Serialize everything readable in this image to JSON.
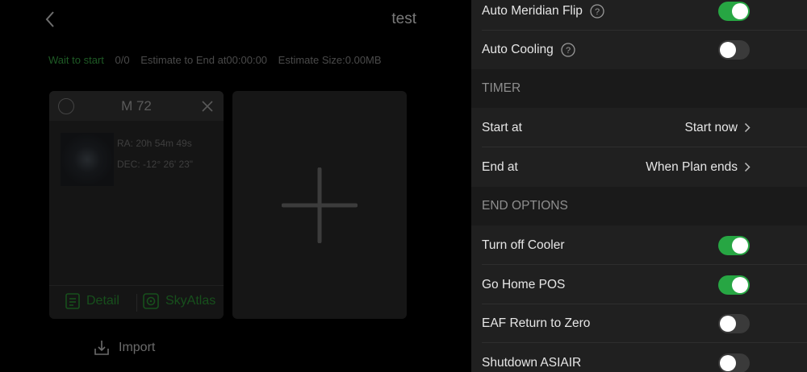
{
  "plan": {
    "title": "test",
    "status": {
      "state": "Wait to start",
      "progress": "0/0",
      "estimate_end": "Estimate to End at00:00:00",
      "estimate_size": "Estimate Size:0.00MB"
    },
    "target": {
      "name": "M 72",
      "ra": "RA: 20h 54m 49s",
      "dec": "DEC: -12° 26' 23\"",
      "detail_label": "Detail",
      "skyatlas_label": "SkyAtlas"
    },
    "import_label": "Import"
  },
  "settings": {
    "auto_meridian_flip": {
      "label": "Auto Meridian Flip",
      "on": true
    },
    "auto_cooling": {
      "label": "Auto Cooling",
      "on": false
    },
    "timer_section": "TIMER",
    "start_at": {
      "label": "Start at",
      "value": "Start now"
    },
    "end_at": {
      "label": "End at",
      "value": "When Plan ends"
    },
    "end_options_section": "END OPTIONS",
    "turn_off_cooler": {
      "label": "Turn off Cooler",
      "on": true
    },
    "go_home_pos": {
      "label": "Go Home POS",
      "on": true
    },
    "eaf_return_zero": {
      "label": "EAF Return to Zero",
      "on": false
    },
    "shutdown_asiair": {
      "label": "Shutdown ASIAIR",
      "on": false
    }
  },
  "colors": {
    "toggle_on": "#27a643",
    "toggle_off": "#3a3a3a",
    "accent_green_dim": "#17501c"
  }
}
